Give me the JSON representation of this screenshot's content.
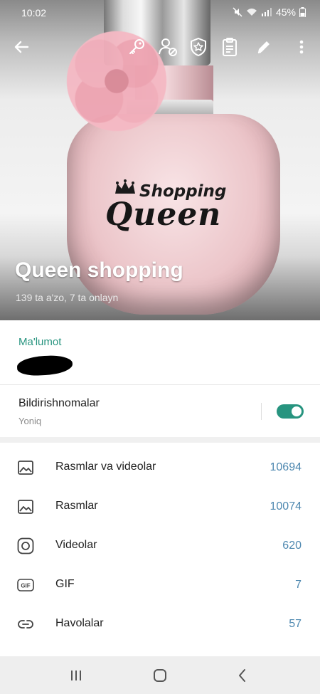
{
  "status_bar": {
    "time": "10:02",
    "battery": "45%"
  },
  "app_bar": {
    "icons": [
      "back-arrow-icon",
      "key-icon",
      "user-block-icon",
      "shield-star-icon",
      "clipboard-icon",
      "pencil-icon",
      "more-vert-icon"
    ]
  },
  "hero": {
    "logo_top_text": "Shopping",
    "logo_bottom_text": "Queen",
    "title": "Queen shopping",
    "subtitle": "139 ta a'zo, 7 ta onlayn"
  },
  "info": {
    "label": "Ma'lumot"
  },
  "notifications": {
    "title": "Bildirishnomalar",
    "status": "Yoniq",
    "enabled": true
  },
  "media": [
    {
      "icon": "image-icon",
      "label": "Rasmlar va videolar",
      "count": "10694"
    },
    {
      "icon": "image-icon",
      "label": "Rasmlar",
      "count": "10074"
    },
    {
      "icon": "video-icon",
      "label": "Videolar",
      "count": "620"
    },
    {
      "icon": "gif-icon",
      "label": "GIF",
      "count": "7"
    },
    {
      "icon": "link-icon",
      "label": "Havolalar",
      "count": "57"
    }
  ],
  "colors": {
    "accent": "#27947f",
    "count": "#4e88b0"
  },
  "nav": {
    "icons": [
      "recent-apps-icon",
      "home-icon",
      "back-icon"
    ]
  }
}
